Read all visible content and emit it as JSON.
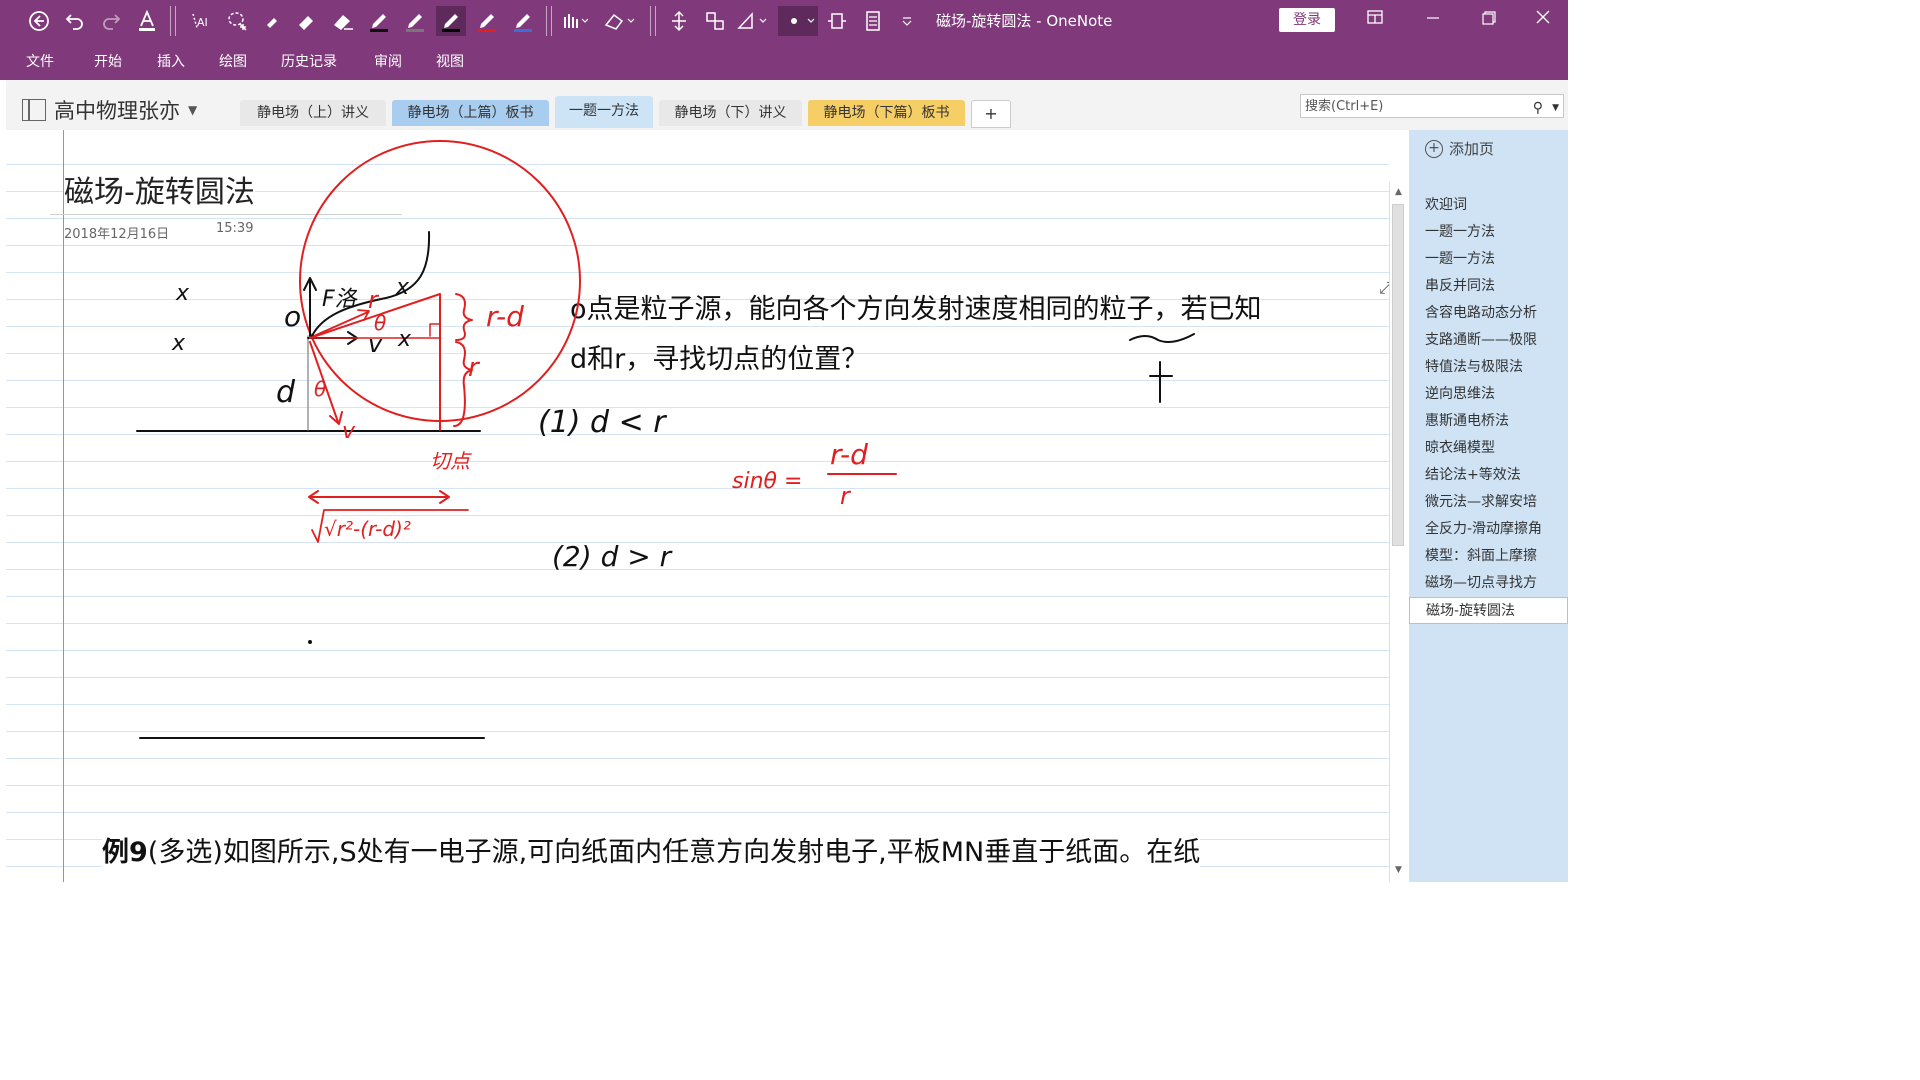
{
  "window": {
    "title": "磁场-旋转圆法 - OneNote",
    "login_label": "登录",
    "accent_color": "#80397b"
  },
  "toolbar": {
    "icons": [
      "back-icon",
      "undo-icon",
      "redo-icon",
      "font-color-icon",
      "lasso-text-icon",
      "lasso-select-icon",
      "eraser-small-icon",
      "eraser-icon",
      "eraser-large-icon",
      "pen-black-icon",
      "pen-gray-icon",
      "pen-black-selected-icon",
      "pen-red-icon",
      "pen-blue-icon",
      "pen-styles-icon",
      "shapes-icon",
      "insert-space-icon",
      "ink-to-shape-icon",
      "ruler-icon",
      "pen-dot-icon",
      "full-page-icon",
      "page-view-icon",
      "customize-icon"
    ]
  },
  "ribbon": {
    "tabs": [
      "文件",
      "开始",
      "插入",
      "绘图",
      "历史记录",
      "审阅",
      "视图"
    ]
  },
  "notebook": {
    "name": "高中物理张亦"
  },
  "section_tabs": [
    {
      "label": "静电场（上）讲义",
      "color": "#e8e8e8"
    },
    {
      "label": "静电场（上篇）板书",
      "color": "#a9cdee"
    },
    {
      "label": "一题一方法",
      "color": "#cde4f7"
    },
    {
      "label": "静电场（下）讲义",
      "color": "#e8e8e8"
    },
    {
      "label": "静电场（下篇）板书",
      "color": "#f5cf66"
    }
  ],
  "add_tab_label": "+",
  "search": {
    "placeholder": "搜索(Ctrl+E)"
  },
  "page": {
    "title": "磁场-旋转圆法",
    "date": "2018年12月16日",
    "time": "15:39",
    "question_line1": "o点是粒子源，能向各个方向发射速度相同的粒子，若已知",
    "question_line2": "d和r，寻找切点的位置？",
    "example_prefix": "例9",
    "example_text": "(多选)如图所示,S处有一电子源,可向纸面内任意方向发射电子,平板MN垂直于纸面。在纸"
  },
  "ink": {
    "label_frz": "F洛",
    "label_r": "r",
    "label_theta": "θ",
    "label_d": "d",
    "label_v": "v",
    "label_o": "o",
    "label_x": "x",
    "label_r_minus_d": "r-d",
    "label_tangent_point": "切点",
    "label_sqrt": "√r²-(r-d)²",
    "case1": "(1)  d < r",
    "case2": "(2)  d > r",
    "sin_lhs": "sinθ =",
    "sin_num": "r-d",
    "sin_den": "r",
    "wave_mark": "〜",
    "cross_mark": "†"
  },
  "page_panel": {
    "add_page_label": "添加页",
    "pages": [
      "欢迎词",
      "一题一方法",
      "一题一方法",
      "串反并同法",
      "含容电路动态分析",
      "支路通断——极限",
      "特值法与极限法",
      "逆向思维法",
      "惠斯通电桥法",
      "晾衣绳模型",
      "结论法+等效法",
      "微元法—求解安培",
      "全反力-滑动摩擦角",
      "模型：斜面上摩擦",
      "磁场—切点寻找方",
      "磁场-旋转圆法"
    ],
    "active_index": 15
  }
}
